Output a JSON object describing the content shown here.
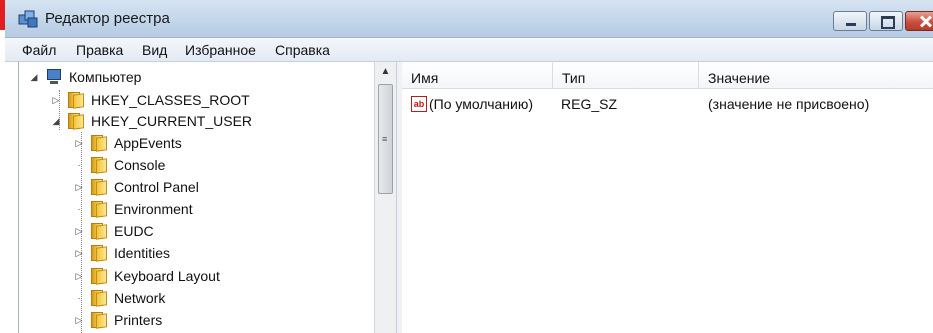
{
  "window": {
    "title": "Редактор реестра"
  },
  "menu": [
    "Файл",
    "Правка",
    "Вид",
    "Избранное",
    "Справка"
  ],
  "tree": {
    "root": "Компьютер",
    "hives": [
      "HKEY_CLASSES_ROOT",
      "HKEY_CURRENT_USER"
    ],
    "children": [
      "AppEvents",
      "Console",
      "Control Panel",
      "Environment",
      "EUDC",
      "Identities",
      "Keyboard Layout",
      "Network",
      "Printers"
    ]
  },
  "list": {
    "columns": [
      "Имя",
      "Тип",
      "Значение"
    ],
    "rows": [
      {
        "name": "(По умолчанию)",
        "type": "REG_SZ",
        "value": "(значение не присвоено)"
      }
    ]
  },
  "icons": {
    "app": "regedit-icon",
    "computer": "computer-icon",
    "folder": "folder-icon",
    "string_value": "string-value-icon"
  }
}
